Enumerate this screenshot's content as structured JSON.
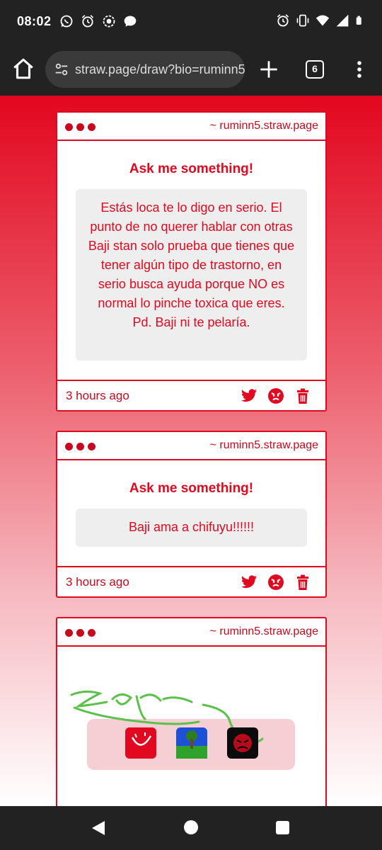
{
  "status_bar": {
    "time": "08:02",
    "left_icons": [
      "whatsapp-icon",
      "alarm-icon",
      "record-icon",
      "chat-icon"
    ],
    "right_icons": [
      "alarm-icon",
      "vibrate-icon",
      "wifi-icon",
      "signal-icon",
      "battery-icon"
    ]
  },
  "browser": {
    "url": "straw.page/draw?bio=ruminn5",
    "tab_count": "6"
  },
  "cards": [
    {
      "site": "~ ruminn5.straw.page",
      "title": "Ask me something!",
      "message": "Estás loca te lo digo en serio. El punto de no querer hablar con otras Baji stan solo prueba que tienes que tener algún tipo de trastorno, en serio busca ayuda porque NO es normal lo pinche toxica que eres. Pd. Baji ni te pelaría.",
      "time": "3 hours ago"
    },
    {
      "site": "~ ruminn5.straw.page",
      "title": "Ask me something!",
      "message": "Baji ama a chifuyu!!!!!!",
      "time": "3 hours ago"
    },
    {
      "site": "~ ruminn5.straw.page"
    }
  ],
  "colors": {
    "accent": "#e0091f",
    "message_bg": "#eeeeee",
    "drawing_stroke": "#5cc14a"
  }
}
